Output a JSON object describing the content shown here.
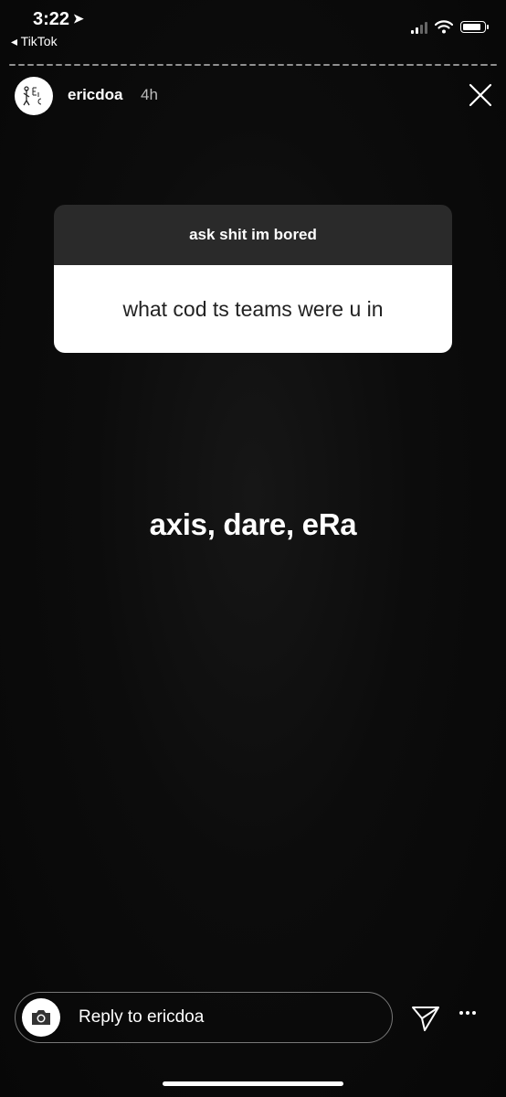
{
  "status_bar": {
    "time": "3:22",
    "back_app": "◂ TikTok"
  },
  "story": {
    "username": "ericdoa",
    "age": "4h",
    "question_prompt": "ask shit im bored",
    "question_text": "what cod ts teams were u in",
    "answer_text": "axis, dare, eRa"
  },
  "reply": {
    "placeholder": "Reply to ericdoa"
  },
  "icons": {
    "location": "location-arrow-icon",
    "close": "close-icon",
    "camera": "camera-icon",
    "send": "send-icon",
    "more": "more-icon"
  }
}
